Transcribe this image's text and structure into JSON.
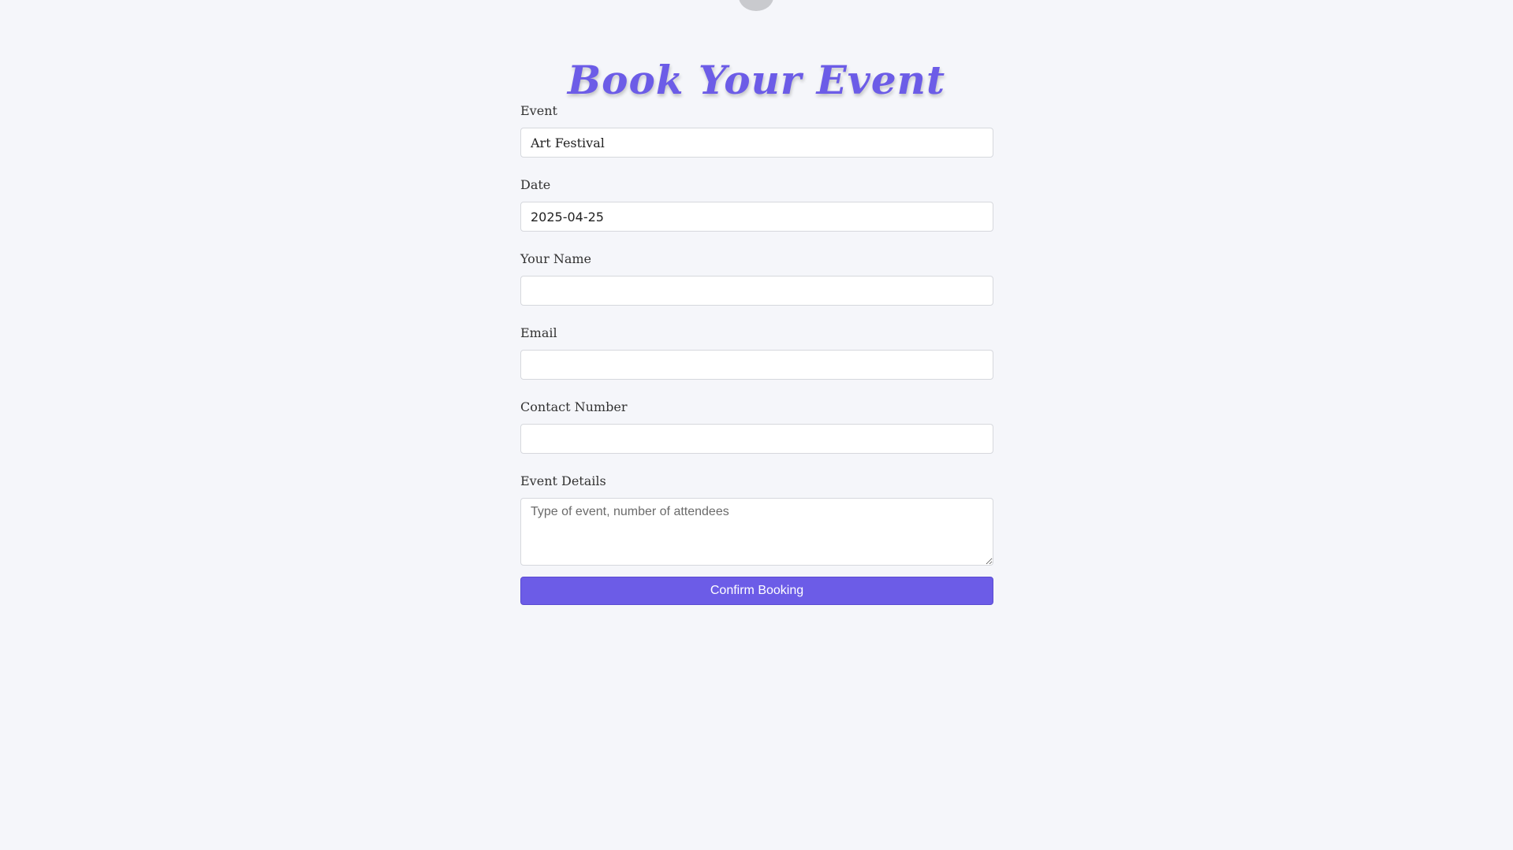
{
  "page": {
    "title": "Book Your Event"
  },
  "form": {
    "event": {
      "label": "Event",
      "value": "Art Festival"
    },
    "date": {
      "label": "Date",
      "value": "2025-04-25"
    },
    "name": {
      "label": "Your Name",
      "value": ""
    },
    "email": {
      "label": "Email",
      "value": ""
    },
    "contact": {
      "label": "Contact Number",
      "value": ""
    },
    "details": {
      "label": "Event Details",
      "placeholder": "Type of event, number of attendees"
    },
    "submit_label": "Confirm Booking"
  },
  "colors": {
    "accent": "#6c5ce7",
    "background": "#f5f6fa"
  }
}
